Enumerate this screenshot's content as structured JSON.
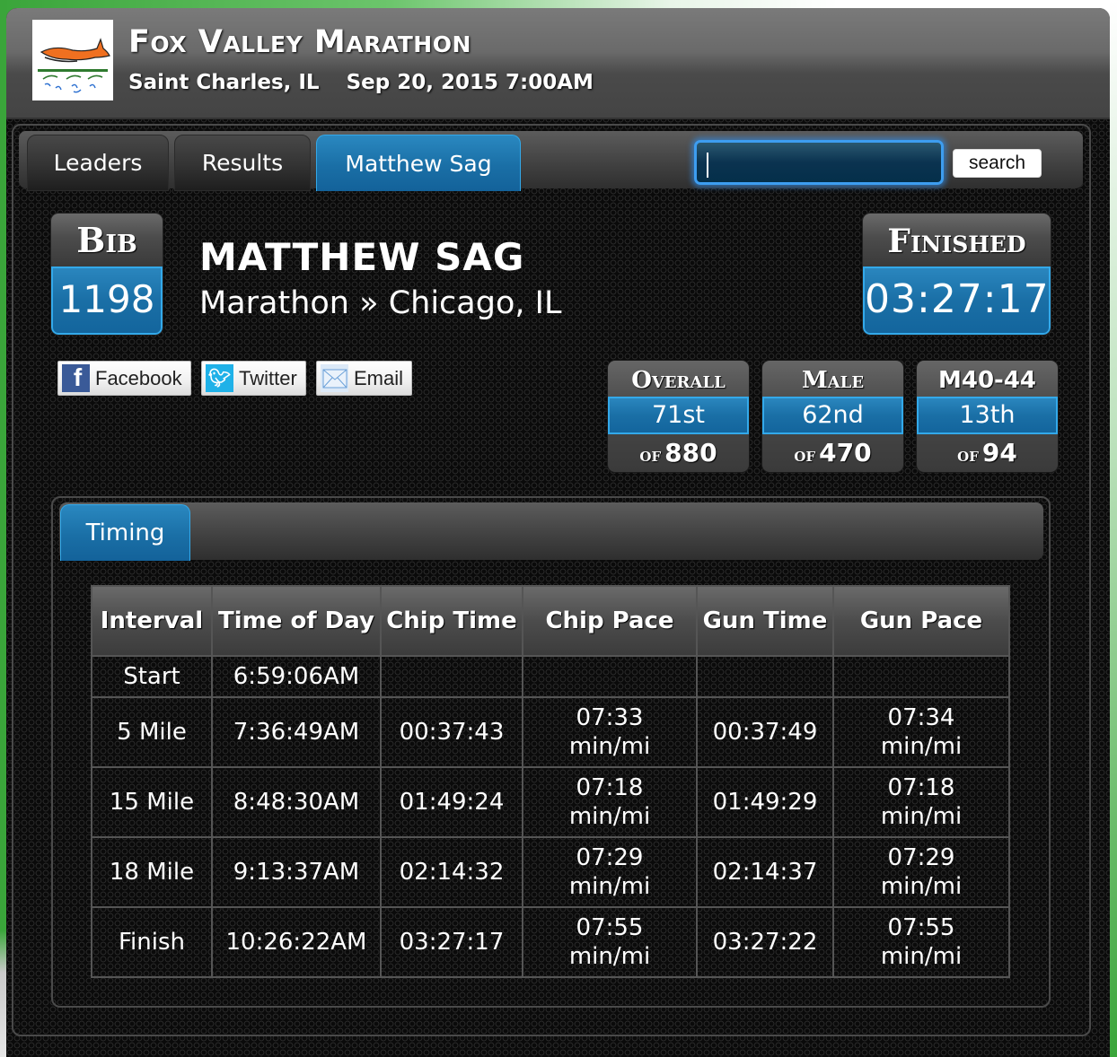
{
  "event": {
    "title": "Fox Valley Marathon",
    "location": "Saint Charles, IL",
    "datetime": "Sep 20, 2015 7:00AM",
    "logo": "fox-valley-logo"
  },
  "nav": {
    "tabs": [
      {
        "label": "Leaders",
        "active": false
      },
      {
        "label": "Results",
        "active": false
      },
      {
        "label": "Matthew Sag",
        "active": true
      }
    ],
    "search": {
      "value": "",
      "placeholder": ""
    },
    "search_button": "search"
  },
  "runner": {
    "bib_label": "Bib",
    "bib": "1198",
    "name": "MATTHEW SAG",
    "race": "Marathon",
    "separator": "»",
    "hometown": "Chicago, IL",
    "finished_label": "Finished",
    "finish_time": "03:27:17"
  },
  "share": [
    {
      "label": "Facebook",
      "icon": "facebook-icon"
    },
    {
      "label": "Twitter",
      "icon": "twitter-icon"
    },
    {
      "label": "Email",
      "icon": "email-icon"
    }
  ],
  "rankings": [
    {
      "label": "Overall",
      "place": "71st",
      "of_label": "of",
      "total": "880"
    },
    {
      "label": "Male",
      "place": "62nd",
      "of_label": "of",
      "total": "470"
    },
    {
      "label": "M40-44",
      "place": "13th",
      "of_label": "of",
      "total": "94"
    }
  ],
  "timing": {
    "tab_label": "Timing",
    "columns": [
      "Interval",
      "Time of Day",
      "Chip Time",
      "Chip Pace",
      "Gun Time",
      "Gun Pace"
    ],
    "rows": [
      {
        "interval": "Start",
        "time_of_day": "6:59:06AM",
        "chip_time": "",
        "chip_pace": "",
        "chip_pace_unit": "",
        "gun_time": "",
        "gun_pace": "",
        "gun_pace_unit": ""
      },
      {
        "interval": "5 Mile",
        "time_of_day": "7:36:49AM",
        "chip_time": "00:37:43",
        "chip_pace": "07:33",
        "chip_pace_unit": "min/mi",
        "gun_time": "00:37:49",
        "gun_pace": "07:34",
        "gun_pace_unit": "min/mi"
      },
      {
        "interval": "15 Mile",
        "time_of_day": "8:48:30AM",
        "chip_time": "01:49:24",
        "chip_pace": "07:18",
        "chip_pace_unit": "min/mi",
        "gun_time": "01:49:29",
        "gun_pace": "07:18",
        "gun_pace_unit": "min/mi"
      },
      {
        "interval": "18 Mile",
        "time_of_day": "9:13:37AM",
        "chip_time": "02:14:32",
        "chip_pace": "07:29",
        "chip_pace_unit": "min/mi",
        "gun_time": "02:14:37",
        "gun_pace": "07:29",
        "gun_pace_unit": "min/mi"
      },
      {
        "interval": "Finish",
        "time_of_day": "10:26:22AM",
        "chip_time": "03:27:17",
        "chip_pace": "07:55",
        "chip_pace_unit": "min/mi",
        "gun_time": "03:27:22",
        "gun_pace": "07:55",
        "gun_pace_unit": "min/mi"
      }
    ]
  },
  "colors": {
    "accent_blue": "#1a6fa6",
    "accent_border": "#33a9ea",
    "background": "#0a0a0a",
    "page_green": "#3aa53a"
  }
}
